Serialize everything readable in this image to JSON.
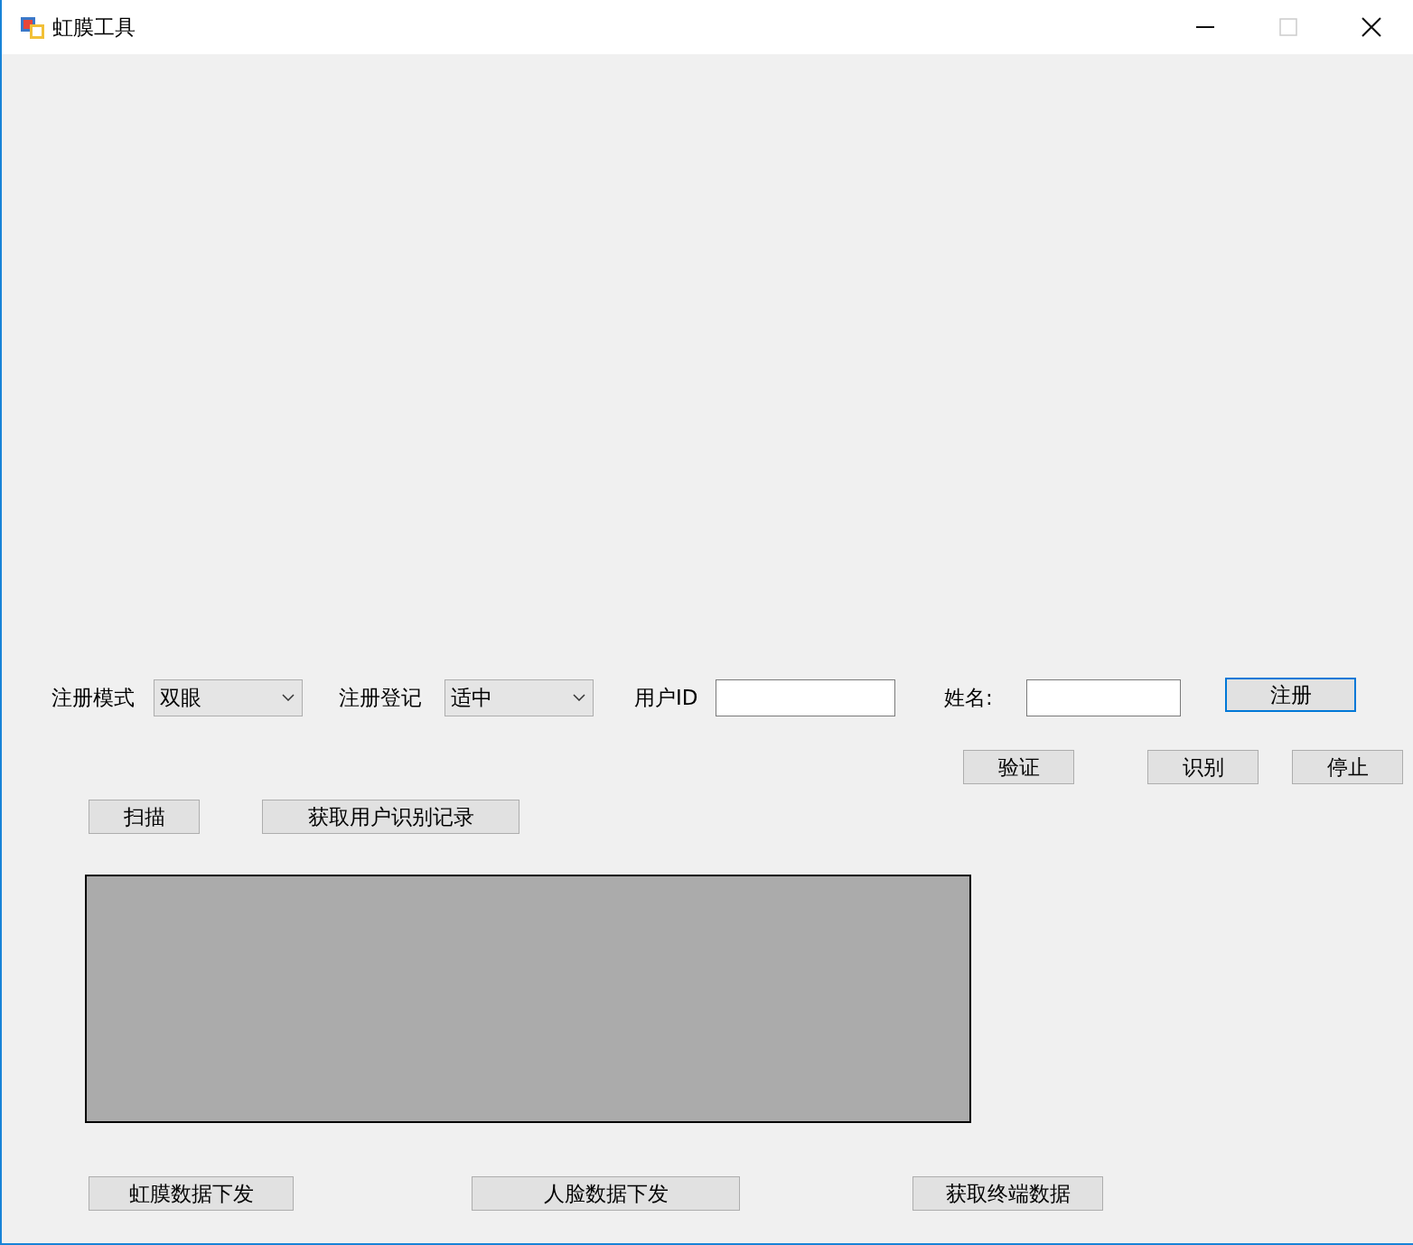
{
  "window": {
    "title": "虹膜工具",
    "controls": [
      {
        "kind": "minimize",
        "disabled": false
      },
      {
        "kind": "maximize",
        "disabled": true
      },
      {
        "kind": "close",
        "disabled": false
      }
    ]
  },
  "registration_row": [
    {
      "kind": "label",
      "text": "注册模式"
    },
    {
      "kind": "combo",
      "value": "双眼"
    },
    {
      "kind": "label",
      "text": "注册登记"
    },
    {
      "kind": "combo",
      "value": "适中"
    },
    {
      "kind": "label",
      "text": "用户ID"
    },
    {
      "kind": "input"
    },
    {
      "kind": "label",
      "text": "姓名:"
    },
    {
      "kind": "input"
    },
    {
      "kind": "button",
      "label": "注册",
      "focused": true
    }
  ],
  "action_buttons": [
    {
      "label": "验证",
      "focused": false
    },
    {
      "label": "识别",
      "focused": false
    },
    {
      "label": "停止",
      "focused": false
    }
  ],
  "scan_buttons": [
    {
      "label": "扫描",
      "focused": false
    },
    {
      "label": "获取用户识别记录",
      "focused": false
    }
  ],
  "bottom_buttons": [
    {
      "label": "虹膜数据下发",
      "focused": false
    },
    {
      "label": "人脸数据下发",
      "focused": false
    },
    {
      "label": "获取终端数据",
      "focused": false
    }
  ]
}
